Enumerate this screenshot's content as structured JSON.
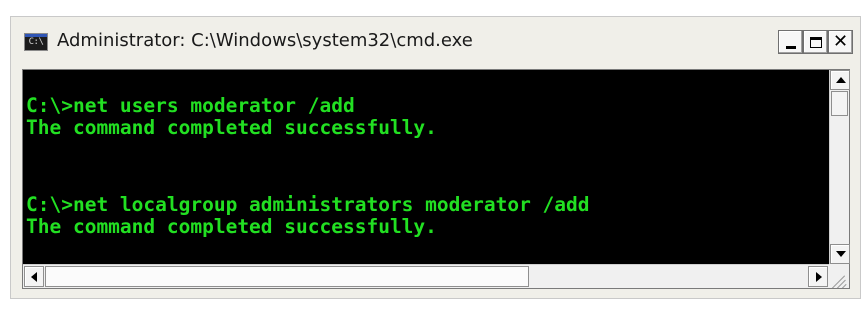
{
  "window": {
    "title": "Administrator: C:\\Windows\\system32\\cmd.exe",
    "icon": "cmd-app-icon",
    "icon_text": "C:\\",
    "controls": [
      "minimize-icon",
      "maximize-icon",
      "close-icon"
    ],
    "close_glyph": "✕"
  },
  "console": {
    "text_color": "#22e022",
    "background": "#000000",
    "lines": [
      "C:\\>net users moderator /add",
      "The command completed successfully.",
      "",
      "C:\\>net localgroup administrators moderator /add",
      "The command completed successfully."
    ]
  }
}
